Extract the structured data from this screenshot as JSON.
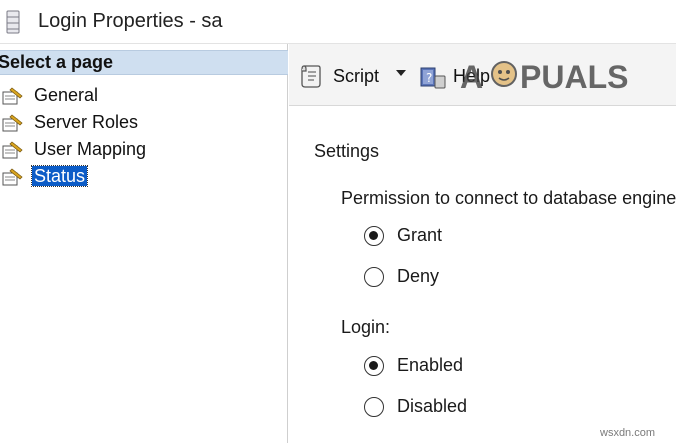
{
  "window": {
    "title": "Login Properties - sa"
  },
  "sidebar": {
    "header": "Select a page",
    "items": [
      {
        "label": "General",
        "selected": false
      },
      {
        "label": "Server Roles",
        "selected": false
      },
      {
        "label": "User Mapping",
        "selected": false
      },
      {
        "label": "Status",
        "selected": true
      }
    ]
  },
  "toolbar": {
    "script_label": "Script",
    "help_label": "Help"
  },
  "settings": {
    "section_label": "Settings",
    "permission": {
      "label": "Permission to connect to database engine",
      "options": [
        {
          "label": "Grant",
          "checked": true
        },
        {
          "label": "Deny",
          "checked": false
        }
      ]
    },
    "login": {
      "label": "Login:",
      "options": [
        {
          "label": "Enabled",
          "checked": true
        },
        {
          "label": "Disabled",
          "checked": false
        }
      ]
    }
  },
  "watermark": {
    "text": "APPUALS",
    "site": "wsxdn.com"
  },
  "colors": {
    "selected_bg": "#0c5cc7",
    "header_bg": "#cfdff0",
    "toolbar_bg": "#f4f4f4"
  }
}
